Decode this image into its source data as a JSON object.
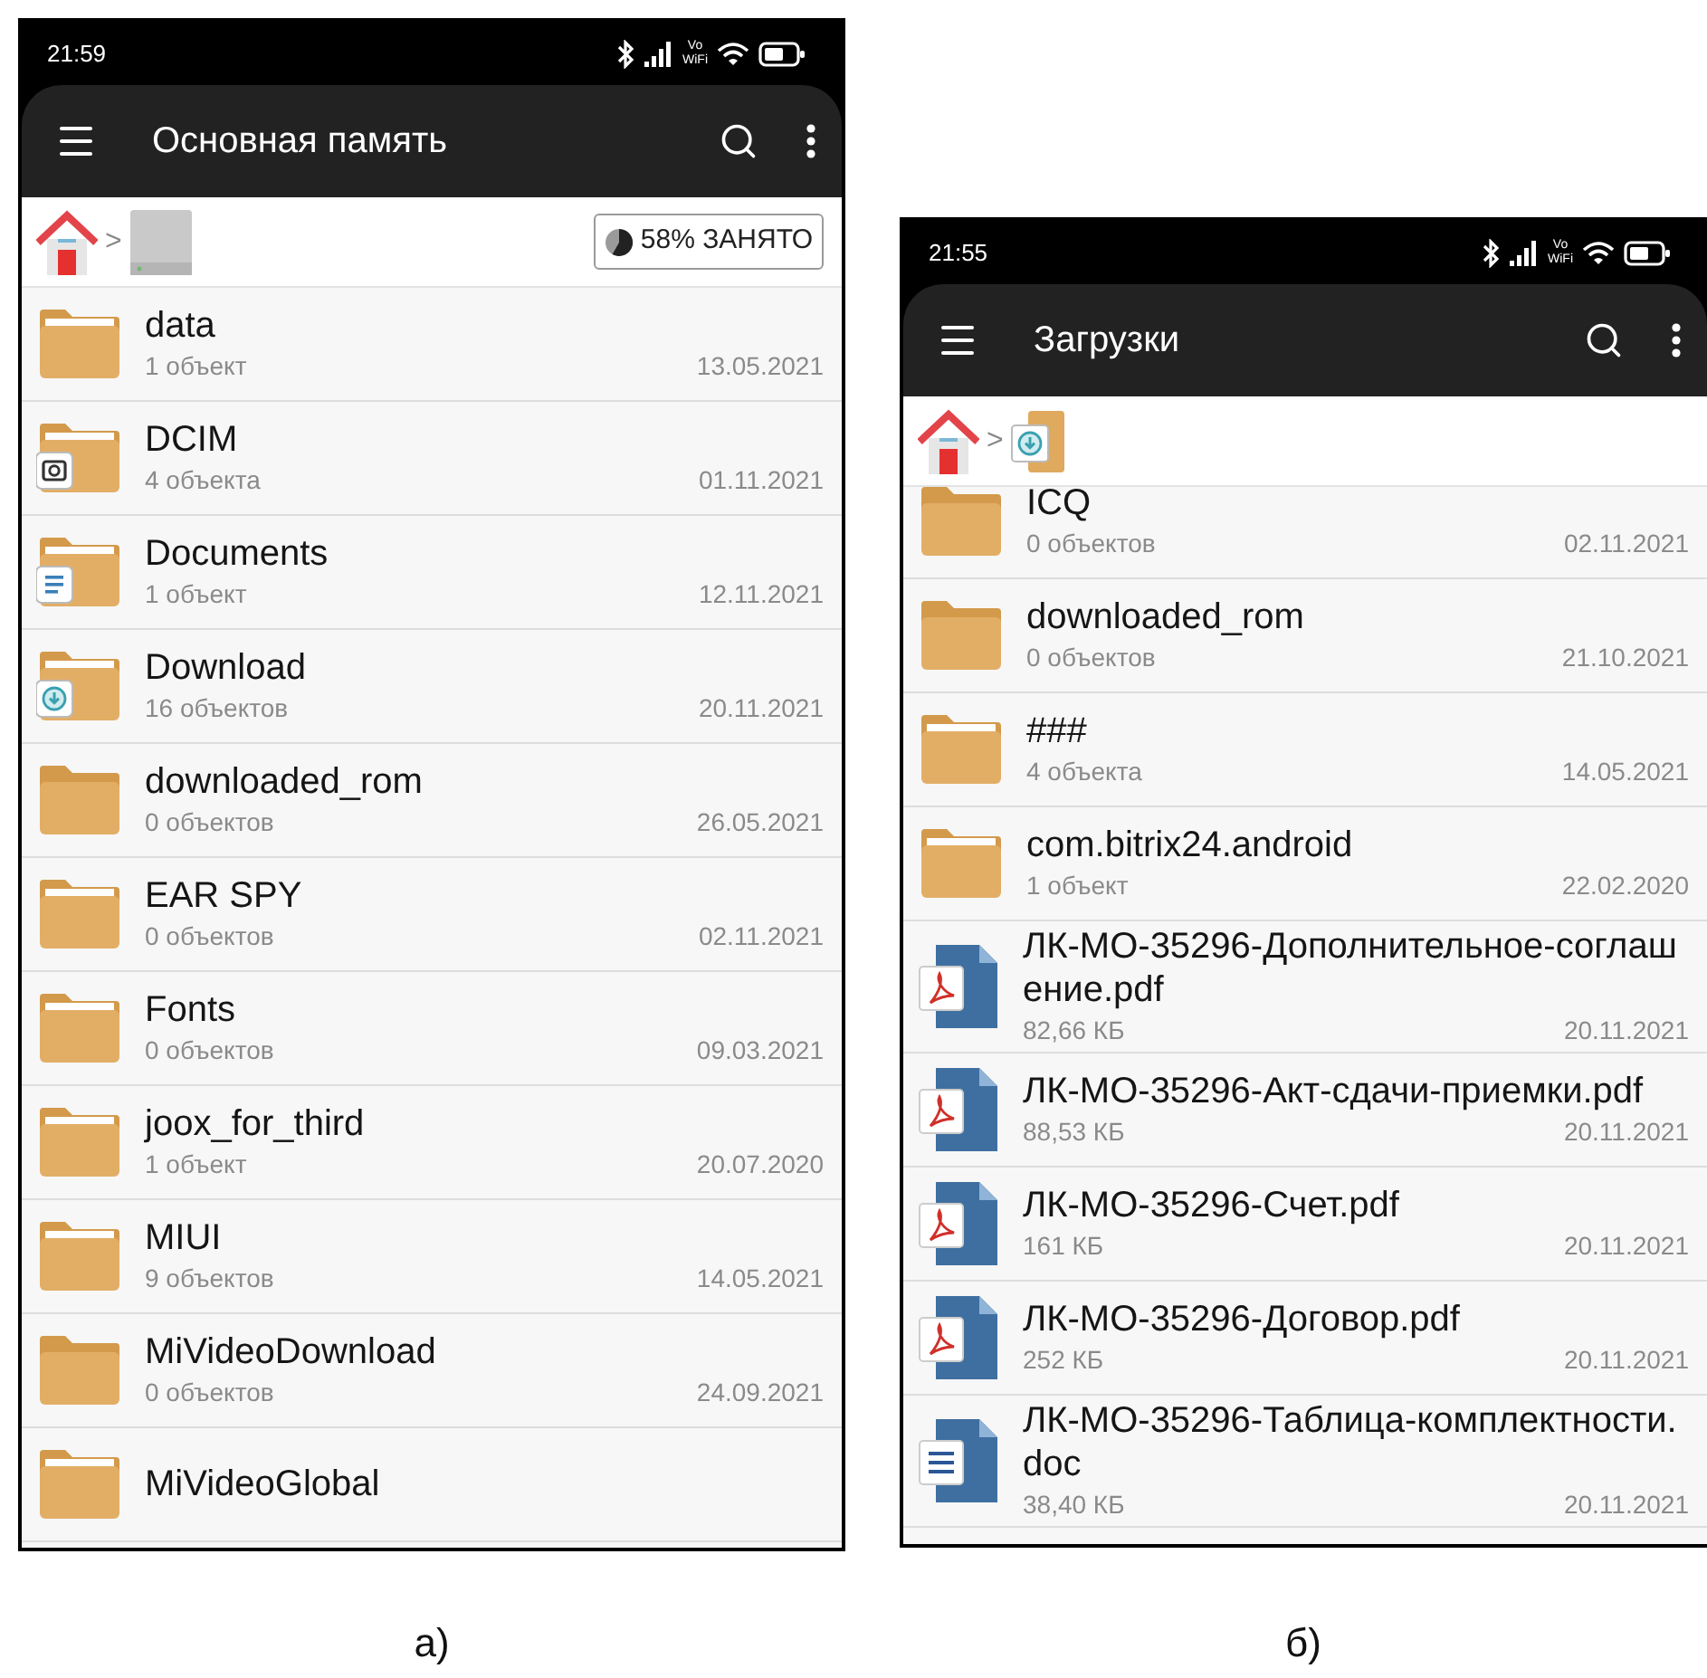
{
  "panels": [
    {
      "caption": "а)",
      "status": {
        "time": "21:59",
        "vowifi_top": "Vo",
        "vowifi_bottom": "WiFi"
      },
      "toolbar": {
        "title": "Основная память"
      },
      "breadcrumb": [
        {
          "kind": "home"
        },
        {
          "kind": "separator",
          "text": ">"
        },
        {
          "kind": "drive"
        }
      ],
      "storage_badge": {
        "text": "58% ЗАНЯТО"
      },
      "scrolled": false,
      "items": [
        {
          "kind": "folder",
          "name": "data",
          "detail": "1 объект",
          "date": "13.05.2021"
        },
        {
          "kind": "camera_folder",
          "name": "DCIM",
          "detail": "4 объекта",
          "date": "01.11.2021"
        },
        {
          "kind": "docs_folder",
          "name": "Documents",
          "detail": "1 объект",
          "date": "12.11.2021"
        },
        {
          "kind": "download_folder",
          "name": "Download",
          "detail": "16 объектов",
          "date": "20.11.2021"
        },
        {
          "kind": "empty_folder",
          "name": "downloaded_rom",
          "detail": "0 объектов",
          "date": "26.05.2021"
        },
        {
          "kind": "folder",
          "name": "EAR SPY",
          "detail": "0 объектов",
          "date": "02.11.2021"
        },
        {
          "kind": "folder",
          "name": "Fonts",
          "detail": "0 объектов",
          "date": "09.03.2021"
        },
        {
          "kind": "folder",
          "name": "joox_for_third",
          "detail": "1 объект",
          "date": "20.07.2020"
        },
        {
          "kind": "folder",
          "name": "MIUI",
          "detail": "9 объектов",
          "date": "14.05.2021"
        },
        {
          "kind": "empty_folder",
          "name": "MiVideoDownload",
          "detail": "0 объектов",
          "date": "24.09.2021"
        },
        {
          "kind": "folder",
          "name": "MiVideoGlobal"
        }
      ]
    },
    {
      "caption": "б)",
      "status": {
        "time": "21:55",
        "vowifi_top": "Vo",
        "vowifi_bottom": "WiFi"
      },
      "toolbar": {
        "title": "Загрузки"
      },
      "breadcrumb": [
        {
          "kind": "home"
        },
        {
          "kind": "separator",
          "text": ">"
        },
        {
          "kind": "downloads"
        }
      ],
      "scrolled": true,
      "items": [
        {
          "kind": "empty_folder",
          "name": "ICQ",
          "detail": "0 объектов",
          "date": "02.11.2021"
        },
        {
          "kind": "empty_folder",
          "name": "downloaded_rom",
          "detail": "0 объектов",
          "date": "21.10.2021"
        },
        {
          "kind": "folder",
          "name": "###",
          "detail": "4 объекта",
          "date": "14.05.2021"
        },
        {
          "kind": "folder",
          "name": "com.bitrix24.android",
          "detail": "1 объект",
          "date": "22.02.2020"
        },
        {
          "kind": "pdf",
          "name": "ЛК-МО-35296-Дополнительное-соглашение.pdf",
          "detail": "82,66 КБ",
          "date": "20.11.2021"
        },
        {
          "kind": "pdf",
          "name": "ЛК-МО-35296-Акт-сдачи-приемки.pdf",
          "detail": "88,53 КБ",
          "date": "20.11.2021"
        },
        {
          "kind": "pdf",
          "name": "ЛК-МО-35296-Счет.pdf",
          "detail": "161 КБ",
          "date": "20.11.2021"
        },
        {
          "kind": "pdf",
          "name": "ЛК-МО-35296-Договор.pdf",
          "detail": "252 КБ",
          "date": "20.11.2021"
        },
        {
          "kind": "doc",
          "name": "ЛК-МО-35296-Таблица-комплектности.doc",
          "detail": "38,40 КБ",
          "date": "20.11.2021"
        }
      ]
    }
  ]
}
